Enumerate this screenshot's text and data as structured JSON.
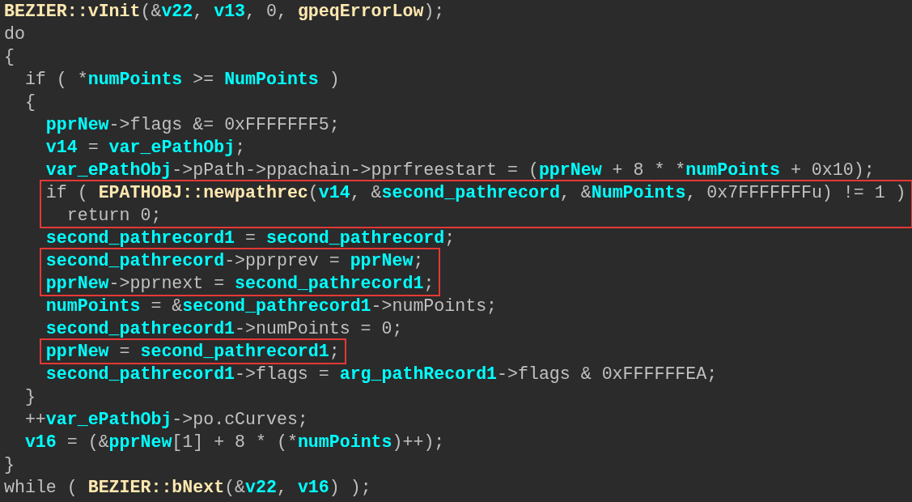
{
  "code": [
    {
      "kind": "line",
      "tokens": [
        {
          "kind": "func",
          "text": "BEZIER::vInit"
        },
        {
          "kind": "plain",
          "text": "(&"
        },
        {
          "kind": "var",
          "text": "v22"
        },
        {
          "kind": "plain",
          "text": ", "
        },
        {
          "kind": "var",
          "text": "v13"
        },
        {
          "kind": "plain",
          "text": ", 0, "
        },
        {
          "kind": "func",
          "text": "gpeqErrorLow"
        },
        {
          "kind": "plain",
          "text": ");"
        }
      ]
    },
    {
      "kind": "line",
      "tokens": [
        {
          "kind": "plain",
          "text": "do"
        }
      ]
    },
    {
      "kind": "line",
      "tokens": [
        {
          "kind": "plain",
          "text": "{"
        }
      ],
      "children": [
        {
          "kind": "line",
          "tokens": [
            {
              "kind": "plain",
              "text": "if ( *"
            },
            {
              "kind": "var",
              "text": "numPoints"
            },
            {
              "kind": "plain",
              "text": " >= "
            },
            {
              "kind": "var",
              "text": "NumPoints"
            },
            {
              "kind": "plain",
              "text": " )"
            }
          ]
        },
        {
          "kind": "line",
          "tokens": [
            {
              "kind": "plain",
              "text": "{"
            }
          ],
          "children": [
            {
              "kind": "line",
              "tokens": [
                {
                  "kind": "var",
                  "text": "pprNew"
                },
                {
                  "kind": "plain",
                  "text": "->flags &= 0xFFFFFFF5;"
                }
              ]
            },
            {
              "kind": "line",
              "tokens": [
                {
                  "kind": "var",
                  "text": "v14"
                },
                {
                  "kind": "plain",
                  "text": " = "
                },
                {
                  "kind": "var",
                  "text": "var_ePathObj"
                },
                {
                  "kind": "plain",
                  "text": ";"
                }
              ]
            },
            {
              "kind": "line",
              "tokens": [
                {
                  "kind": "var",
                  "text": "var_ePathObj"
                },
                {
                  "kind": "plain",
                  "text": "->pPath->ppachain->pprfreestart = ("
                },
                {
                  "kind": "var",
                  "text": "pprNew"
                },
                {
                  "kind": "plain",
                  "text": " + 8 * *"
                },
                {
                  "kind": "var",
                  "text": "numPoints"
                },
                {
                  "kind": "plain",
                  "text": " + 0x10);"
                }
              ]
            },
            {
              "kind": "boxed",
              "lines": [
                {
                  "kind": "line",
                  "tokens": [
                    {
                      "kind": "plain",
                      "text": "if ( "
                    },
                    {
                      "kind": "func",
                      "text": "EPATHOBJ::newpathrec"
                    },
                    {
                      "kind": "plain",
                      "text": "("
                    },
                    {
                      "kind": "var",
                      "text": "v14"
                    },
                    {
                      "kind": "plain",
                      "text": ", &"
                    },
                    {
                      "kind": "var",
                      "text": "second_pathrecord"
                    },
                    {
                      "kind": "plain",
                      "text": ", &"
                    },
                    {
                      "kind": "var",
                      "text": "NumPoints"
                    },
                    {
                      "kind": "plain",
                      "text": ", 0x7FFFFFFFu) != 1 )"
                    }
                  ],
                  "children": [
                    {
                      "kind": "line",
                      "tokens": [
                        {
                          "kind": "plain",
                          "text": "return 0;"
                        }
                      ]
                    }
                  ]
                }
              ]
            },
            {
              "kind": "line",
              "tokens": [
                {
                  "kind": "var",
                  "text": "second_pathrecord1"
                },
                {
                  "kind": "plain",
                  "text": " = "
                },
                {
                  "kind": "var",
                  "text": "second_pathrecord"
                },
                {
                  "kind": "plain",
                  "text": ";"
                }
              ]
            },
            {
              "kind": "boxed",
              "lines": [
                {
                  "kind": "line",
                  "tokens": [
                    {
                      "kind": "var",
                      "text": "second_pathrecord"
                    },
                    {
                      "kind": "plain",
                      "text": "->pprprev = "
                    },
                    {
                      "kind": "var",
                      "text": "pprNew"
                    },
                    {
                      "kind": "plain",
                      "text": ";"
                    }
                  ]
                },
                {
                  "kind": "line",
                  "tokens": [
                    {
                      "kind": "var",
                      "text": "pprNew"
                    },
                    {
                      "kind": "plain",
                      "text": "->pprnext = "
                    },
                    {
                      "kind": "var",
                      "text": "second_pathrecord1"
                    },
                    {
                      "kind": "plain",
                      "text": ";"
                    }
                  ]
                }
              ]
            },
            {
              "kind": "line",
              "tokens": [
                {
                  "kind": "var",
                  "text": "numPoints"
                },
                {
                  "kind": "plain",
                  "text": " = &"
                },
                {
                  "kind": "var",
                  "text": "second_pathrecord1"
                },
                {
                  "kind": "plain",
                  "text": "->numPoints;"
                }
              ]
            },
            {
              "kind": "line",
              "tokens": [
                {
                  "kind": "var",
                  "text": "second_pathrecord1"
                },
                {
                  "kind": "plain",
                  "text": "->numPoints = 0;"
                }
              ]
            },
            {
              "kind": "boxed",
              "lines": [
                {
                  "kind": "line",
                  "tokens": [
                    {
                      "kind": "var",
                      "text": "pprNew"
                    },
                    {
                      "kind": "plain",
                      "text": " = "
                    },
                    {
                      "kind": "var",
                      "text": "second_pathrecord1"
                    },
                    {
                      "kind": "plain",
                      "text": ";"
                    }
                  ]
                }
              ]
            },
            {
              "kind": "line",
              "tokens": [
                {
                  "kind": "var",
                  "text": "second_pathrecord1"
                },
                {
                  "kind": "plain",
                  "text": "->flags = "
                },
                {
                  "kind": "var",
                  "text": "arg_pathRecord1"
                },
                {
                  "kind": "plain",
                  "text": "->flags & 0xFFFFFFEA;"
                }
              ]
            }
          ]
        },
        {
          "kind": "line",
          "tokens": [
            {
              "kind": "plain",
              "text": "}"
            }
          ]
        },
        {
          "kind": "line",
          "tokens": [
            {
              "kind": "plain",
              "text": "++"
            },
            {
              "kind": "var",
              "text": "var_ePathObj"
            },
            {
              "kind": "plain",
              "text": "->po.cCurves;"
            }
          ]
        },
        {
          "kind": "line",
          "tokens": [
            {
              "kind": "var",
              "text": "v16"
            },
            {
              "kind": "plain",
              "text": " = (&"
            },
            {
              "kind": "var",
              "text": "pprNew"
            },
            {
              "kind": "plain",
              "text": "[1] + 8 * (*"
            },
            {
              "kind": "var",
              "text": "numPoints"
            },
            {
              "kind": "plain",
              "text": ")++);"
            }
          ]
        }
      ]
    },
    {
      "kind": "line",
      "tokens": [
        {
          "kind": "plain",
          "text": "}"
        }
      ]
    },
    {
      "kind": "line",
      "tokens": [
        {
          "kind": "plain",
          "text": "while ( "
        },
        {
          "kind": "func",
          "text": "BEZIER::bNext"
        },
        {
          "kind": "plain",
          "text": "(&"
        },
        {
          "kind": "var",
          "text": "v22"
        },
        {
          "kind": "plain",
          "text": ", "
        },
        {
          "kind": "var",
          "text": "v16"
        },
        {
          "kind": "plain",
          "text": ") );"
        }
      ]
    }
  ]
}
